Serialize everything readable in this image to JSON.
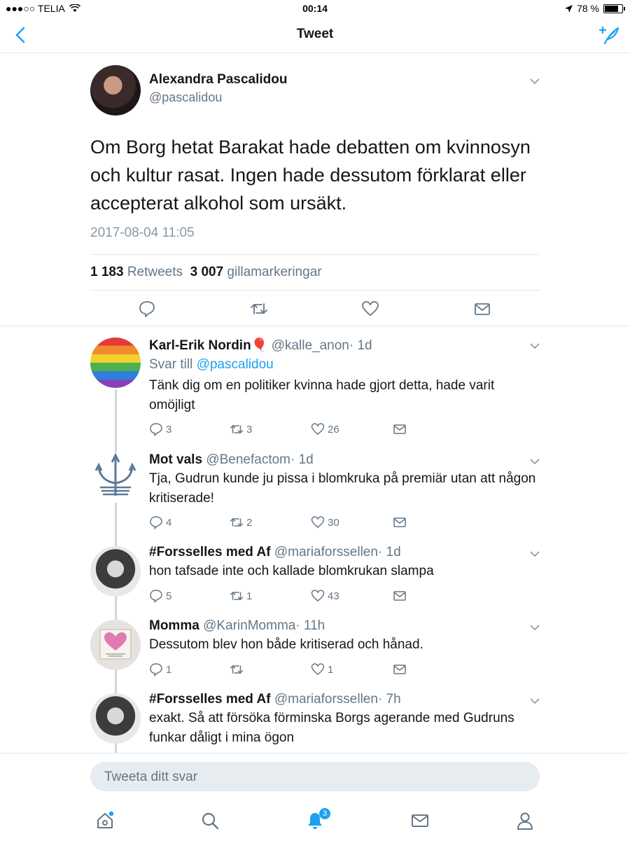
{
  "status_bar": {
    "carrier": "●●●○○ TELIA",
    "time": "00:14",
    "battery": "78 %",
    "battery_level": 0.78
  },
  "nav": {
    "title": "Tweet"
  },
  "tweet": {
    "author_name": "Alexandra Pascalidou",
    "author_handle": "@pascalidou",
    "text": "Om Borg hetat Barakat hade debatten om kvinnosyn och kultur rasat. Ingen hade dessutom förklarat eller accepterat alkohol som ursäkt.",
    "timestamp": "2017-08-04 11:05",
    "retweets": "1 183",
    "retweets_label": "Retweets",
    "likes": "3 007",
    "likes_label": "gillamarkeringar"
  },
  "replies": [
    {
      "name": "Karl-Erik Nordin",
      "emoji": "🎈",
      "handle": "@kalle_anon",
      "time": "· 1d",
      "reply_to_label": "Svar till",
      "reply_to_handle": "@pascalidou",
      "text": "Tänk dig om en politiker kvinna hade gjort detta, hade varit omöjligt",
      "reply_count": "3",
      "retweet_count": "3",
      "like_count": "26"
    },
    {
      "name": "Mot vals",
      "handle": "@Benefactom",
      "time": "· 1d",
      "text": "Tja, Gudrun kunde ju pissa i blomkruka på premiär utan att någon kritiserade!",
      "reply_count": "4",
      "retweet_count": "2",
      "like_count": "30"
    },
    {
      "name": "#Forsselles med Af",
      "handle": "@mariaforssellen",
      "time": "· 1d",
      "text": "hon tafsade inte och kallade blomkrukan slampa",
      "reply_count": "5",
      "retweet_count": "1",
      "like_count": "43"
    },
    {
      "name": "Momma",
      "handle": "@KarinMomma",
      "time": "· 11h",
      "text": "Dessutom blev hon både kritiserad och hånad.",
      "reply_count": "1",
      "retweet_count": "",
      "like_count": "1"
    },
    {
      "name": "#Forsselles med Af",
      "handle": "@mariaforssellen",
      "time": "· 7h",
      "text": "exakt. Så att försöka förminska Borgs agerande med Gudruns funkar dåligt i mina ögon"
    }
  ],
  "reply_input": {
    "placeholder": "Tweeta ditt svar"
  },
  "tab_bar": {
    "notifications_badge": "3"
  },
  "colors": {
    "accent": "#1da1f2",
    "secondary_text": "#657786",
    "divider": "#e1e8ed"
  }
}
